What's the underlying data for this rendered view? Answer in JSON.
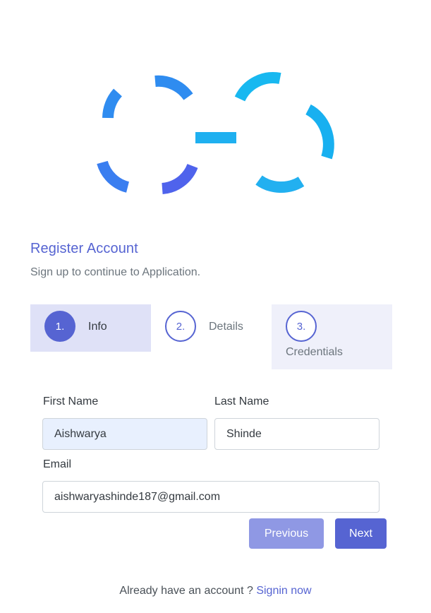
{
  "header": {
    "title": "Register Account",
    "subtitle": "Sign up to continue to Application."
  },
  "steps": [
    {
      "number": "1.",
      "label": "Info",
      "active": true
    },
    {
      "number": "2.",
      "label": "Details",
      "active": false
    },
    {
      "number": "3.",
      "label": "Credentials",
      "active": false
    }
  ],
  "form": {
    "first_name": {
      "label": "First Name",
      "value": "Aishwarya"
    },
    "last_name": {
      "label": "Last Name",
      "value": "Shinde"
    },
    "email": {
      "label": "Email",
      "value": "aishwaryashinde187@gmail.com"
    }
  },
  "buttons": {
    "previous": "Previous",
    "next": "Next"
  },
  "footer": {
    "text": "Already have an account ? ",
    "link": "Signin now"
  },
  "colors": {
    "accent": "#5664d2",
    "logo_gradient_start": "#3b82f6",
    "logo_gradient_end": "#0ea5e9"
  },
  "icons": {
    "logo": "infinity-dashed-logo"
  }
}
